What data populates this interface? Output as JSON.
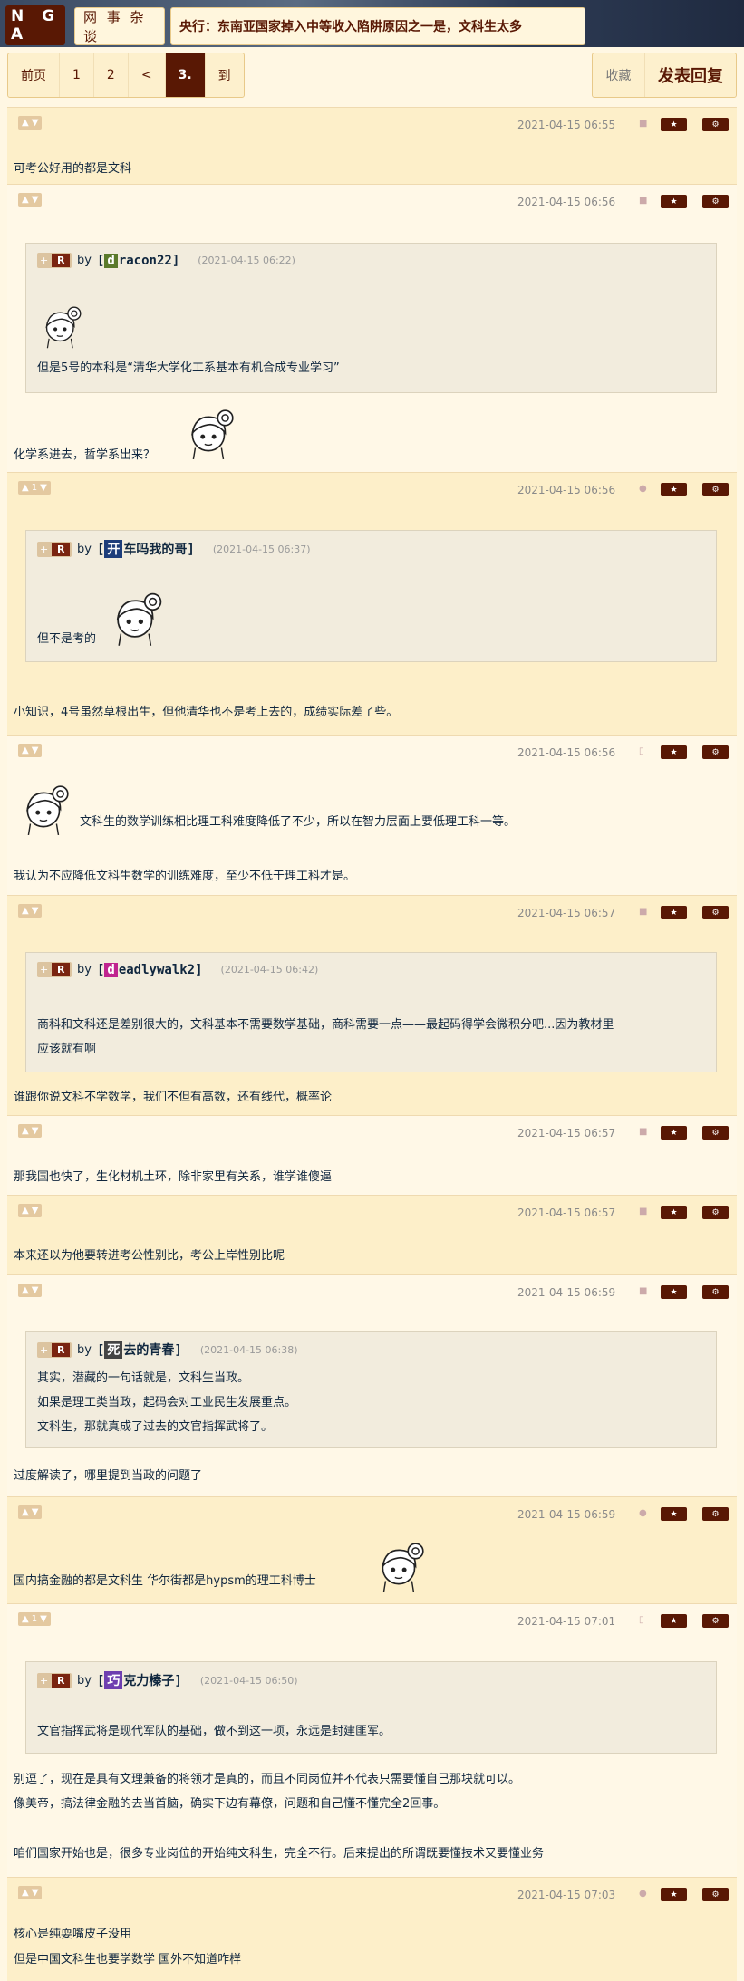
{
  "header": {
    "logo": "N G A",
    "board": "网 事 杂 谈",
    "thread_title": "央行：东南亚国家掉入中等收入陷阱原因之一是，文科生太多"
  },
  "pager": {
    "items": [
      "前页",
      "1",
      "2",
      "<",
      "3.",
      "到"
    ],
    "current": "3."
  },
  "actions": {
    "favorite": "收藏",
    "reply": "发表回复"
  },
  "icons": {
    "upvote": "thumbs-up-icon",
    "downvote": "thumbs-down-icon",
    "star": "star-icon",
    "settings": "gear-icon"
  },
  "posts": [
    {
      "votes": "",
      "time": "2021-04-15 06:55",
      "device": "android-icon",
      "lines": [
        "可考公好用的都是文科"
      ]
    },
    {
      "votes": "",
      "time": "2021-04-15 06:56",
      "device": "android-icon",
      "quote": {
        "initial": "d",
        "user": "racon22]",
        "date": "(2021-04-15 06:22)",
        "lines": [
          "但是5号的本科是“清华大学化工系基本有机合成专业学习”"
        ]
      },
      "lines": [
        "化学系进去，哲学系出来？"
      ]
    },
    {
      "votes": "1",
      "time": "2021-04-15 06:56",
      "device": "apple-icon",
      "quote": {
        "initial": "开",
        "user": "车吗我的哥]",
        "date": "(2021-04-15 06:37)",
        "lines": [
          "但不是考的"
        ]
      },
      "lines": [
        "小知识，4号虽然草根出生，但他清华也不是考上去的，成绩实际差了些。"
      ]
    },
    {
      "votes": "",
      "time": "2021-04-15 06:56",
      "device": "phone-icon",
      "lines": [
        "文科生的数学训练相比理工科难度降低了不少，所以在智力层面上要低理工科一等。",
        "我认为不应降低文科生数学的训练难度，至少不低于理工科才是。"
      ]
    },
    {
      "votes": "",
      "time": "2021-04-15 06:57",
      "device": "android-icon",
      "quote": {
        "initial": "d",
        "user": "eadlywalk2]",
        "date": "(2021-04-15 06:42)",
        "lines": [
          "商科和文科还是差别很大的，文科基本不需要数学基础，商科需要一点——最起码得学会微积分吧...因为教材里",
          "应该就有啊"
        ]
      },
      "lines": [
        "谁跟你说文科不学数学，我们不但有高数，还有线代，概率论"
      ]
    },
    {
      "votes": "",
      "time": "2021-04-15 06:57",
      "device": "android-icon",
      "lines": [
        "那我国也快了，生化材机土环，除非家里有关系，谁学谁傻逼"
      ]
    },
    {
      "votes": "",
      "time": "2021-04-15 06:57",
      "device": "android-icon",
      "lines": [
        "本来还以为他要转进考公性别比，考公上岸性别比呢"
      ]
    },
    {
      "votes": "",
      "time": "2021-04-15 06:59",
      "device": "android-icon",
      "quote": {
        "initial": "死",
        "user": "去的青春]",
        "date": "(2021-04-15 06:38)",
        "lines": [
          "其实，潜藏的一句话就是，文科生当政。",
          "如果是理工类当政，起码会对工业民生发展重点。",
          "文科生，那就真成了过去的文官指挥武将了。"
        ]
      },
      "lines": [
        "过度解读了，哪里提到当政的问题了"
      ]
    },
    {
      "votes": "",
      "time": "2021-04-15 06:59",
      "device": "apple-icon",
      "lines": [
        "国内搞金融的都是文科生 华尔街都是hypsm的理工科博士"
      ]
    },
    {
      "votes": "1",
      "time": "2021-04-15 07:01",
      "device": "phone-icon",
      "quote": {
        "initial": "巧",
        "user": "克力榛子]",
        "date": "(2021-04-15 06:50)",
        "lines": [
          "文官指挥武将是现代军队的基础，做不到这一项，永远是封建匪军。"
        ]
      },
      "lines": [
        "别逗了，现在是具有文理兼备的将领才是真的，而且不同岗位并不代表只需要懂自己那块就可以。",
        "像美帝，搞法律金融的去当首脑，确实下边有幕僚，问题和自己懂不懂完全2回事。",
        "",
        "咱们国家开始也是，很多专业岗位的开始纯文科生，完全不行。后来提出的所谓既要懂技术又要懂业务"
      ]
    },
    {
      "votes": "",
      "time": "2021-04-15 07:03",
      "device": "apple-icon",
      "lines": [
        "核心是纯耍嘴皮子没用",
        "但是中国文科生也要学数学 国外不知道咋样"
      ]
    }
  ]
}
